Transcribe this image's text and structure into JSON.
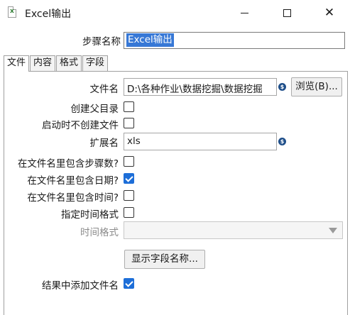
{
  "window": {
    "title": "Excel输出",
    "minimize_icon": "minimize-icon",
    "maximize_icon": "maximize-icon",
    "close_icon": "close-icon"
  },
  "step": {
    "label": "步骤名称",
    "value": "Excel输出"
  },
  "tabs": [
    {
      "label": "文件",
      "active": true
    },
    {
      "label": "内容",
      "active": false
    },
    {
      "label": "格式",
      "active": false
    },
    {
      "label": "字段",
      "active": false
    }
  ],
  "file_tab": {
    "filename": {
      "label": "文件名",
      "value": "D:\\各种作业\\数据挖掘\\数据挖掘"
    },
    "browse_button": "浏览(B)...",
    "create_parent": {
      "label": "创建父目录",
      "checked": false
    },
    "no_create_on_start": {
      "label": "启动时不创建文件",
      "checked": false
    },
    "extension": {
      "label": "扩展名",
      "value": "xls"
    },
    "include_stepnr": {
      "label": "在文件名里包含步骤数?",
      "checked": false
    },
    "include_date": {
      "label": "在文件名里包含日期?",
      "checked": true
    },
    "include_time": {
      "label": "在文件名里包含时间?",
      "checked": false
    },
    "specify_time_format": {
      "label": "指定时间格式",
      "checked": false
    },
    "time_format": {
      "label": "时间格式",
      "value": ""
    },
    "show_fields_button": "显示字段名称...",
    "add_filename_result": {
      "label": "结果中添加文件名",
      "checked": true
    }
  },
  "colors": {
    "accent": "#1d6ed8",
    "selection": "#3778d6",
    "variable_icon": "#1f4f8a"
  }
}
